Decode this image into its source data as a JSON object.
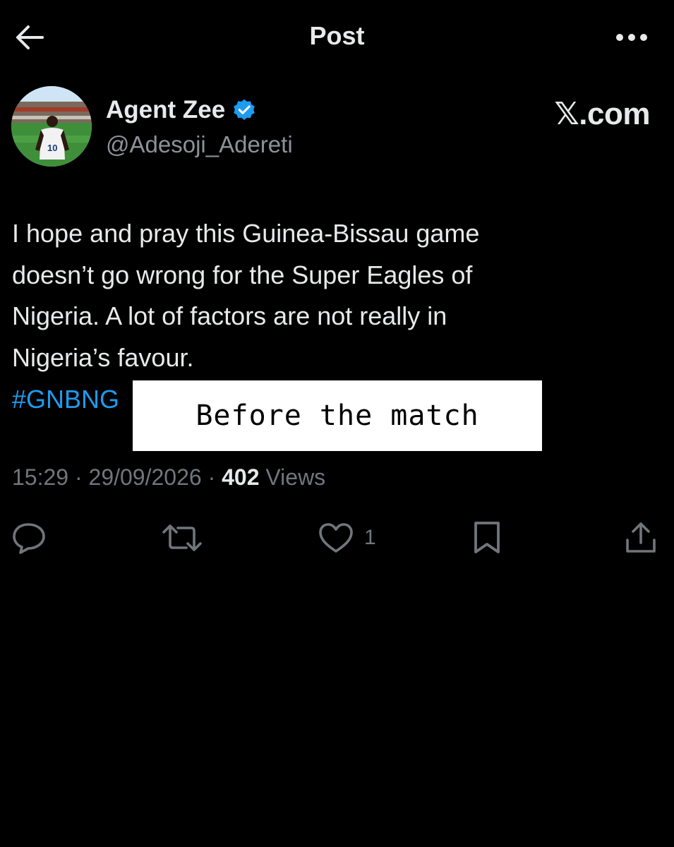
{
  "header": {
    "title": "Post",
    "back_icon": "arrow-left-icon",
    "more_icon": "ellipsis-icon"
  },
  "author": {
    "display_name": "Agent Zee",
    "handle": "@Adesoji_Adereti",
    "verified": true,
    "verified_color": "#1d9bf0",
    "avatar_jersey_number": "10"
  },
  "watermark": "𝕏.com",
  "post": {
    "text": "I hope and pray this Guinea-Bissau game\ndoesn’t go wrong for the Super Eagles of\nNigeria. A lot of factors are not really in\nNigeria’s favour.",
    "hashtag": "#GNBNG",
    "overlay_caption": "Before the match"
  },
  "meta": {
    "time": "15:29",
    "separator": "·",
    "date": "29/09/2026",
    "views_count": "402",
    "views_label": "Views"
  },
  "actions": {
    "reply_icon": "reply-icon",
    "repost_icon": "repost-icon",
    "like_icon": "heart-icon",
    "like_count": "1",
    "bookmark_icon": "bookmark-icon",
    "share_icon": "share-icon"
  },
  "colors": {
    "background": "#000000",
    "text_primary": "#e7e9ea",
    "text_secondary": "#71767b",
    "link": "#1d9bf0"
  }
}
